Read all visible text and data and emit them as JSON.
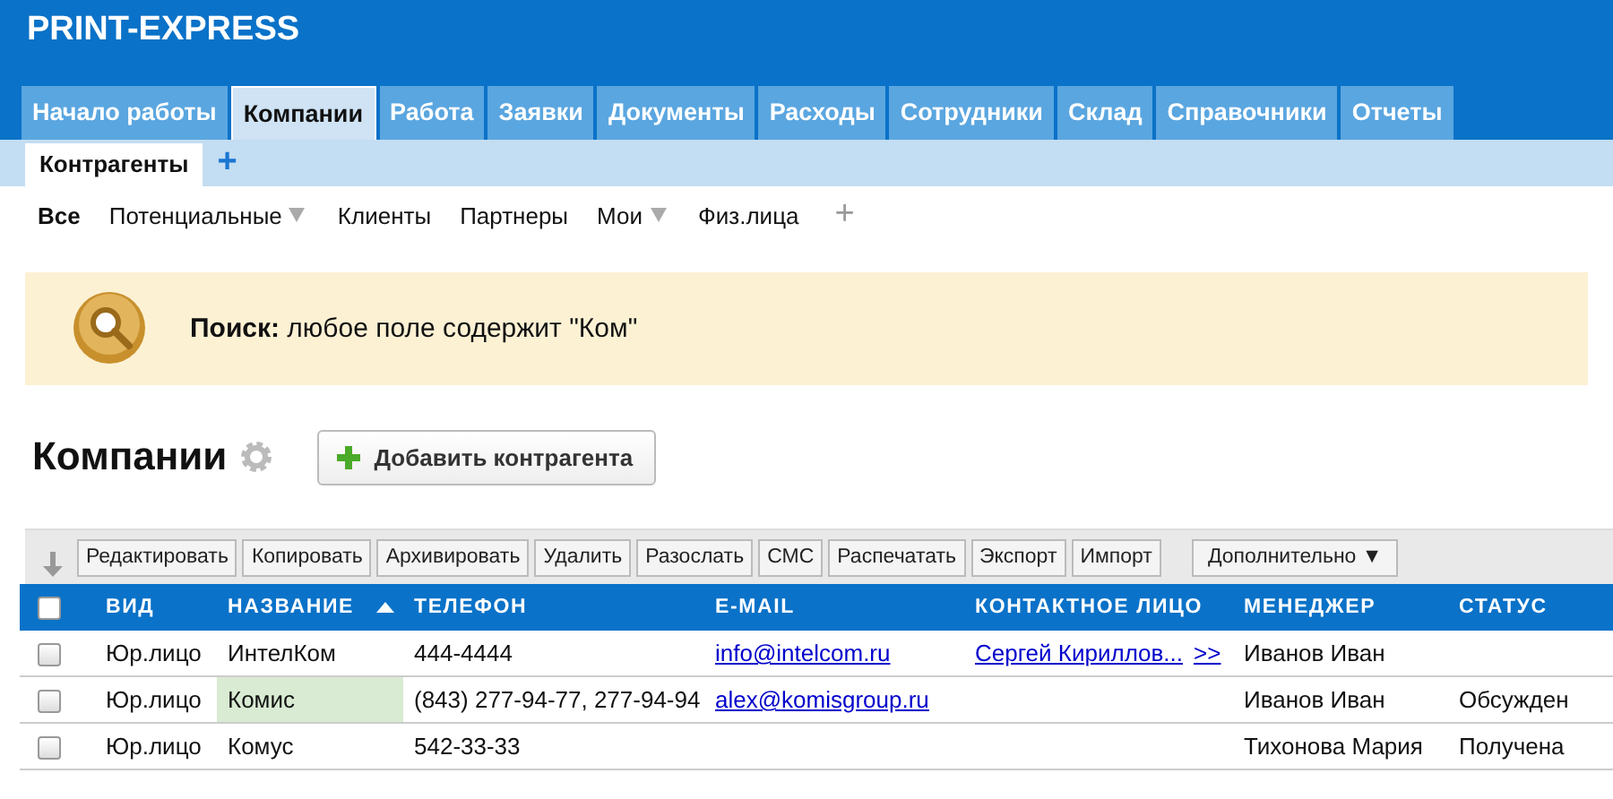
{
  "app_title": "PRINT-EXPRESS",
  "tabs": [
    {
      "label": "Начало работы",
      "selected": false
    },
    {
      "label": "Компании",
      "selected": true
    },
    {
      "label": "Работа",
      "selected": false
    },
    {
      "label": "Заявки",
      "selected": false
    },
    {
      "label": "Документы",
      "selected": false
    },
    {
      "label": "Расходы",
      "selected": false
    },
    {
      "label": "Сотрудники",
      "selected": false
    },
    {
      "label": "Склад",
      "selected": false
    },
    {
      "label": "Справочники",
      "selected": false
    },
    {
      "label": "Отчеты",
      "selected": false
    }
  ],
  "subtabs": [
    {
      "label": "Контрагенты",
      "selected": true
    }
  ],
  "subtab_add": "+",
  "filters": [
    {
      "label": "Все",
      "selected": true,
      "dropdown": false
    },
    {
      "label": "Потенциальные",
      "selected": false,
      "dropdown": true
    },
    {
      "label": "Клиенты",
      "selected": false,
      "dropdown": false
    },
    {
      "label": "Партнеры",
      "selected": false,
      "dropdown": false
    },
    {
      "label": "Мои",
      "selected": false,
      "dropdown": true
    },
    {
      "label": "Физ.лица",
      "selected": false,
      "dropdown": false
    }
  ],
  "filter_add": "+",
  "search_notice": "**Поиск:** любое поле содержит \"Ком\"",
  "heading": "Компании",
  "add_button": "Добавить контрагента",
  "toolbar": [
    "Редактировать",
    "Копировать",
    "Архивировать",
    "Удалить",
    "Разослать",
    "СМС",
    "Распечатать",
    "Экспорт",
    "Импорт"
  ],
  "more_button": "Дополнительно ▼",
  "table": {
    "all_checked": false,
    "columns": [
      {
        "label": "ВИД",
        "sorted": false
      },
      {
        "label": "НАЗВАНИЕ",
        "sorted": true
      },
      {
        "label": "ТЕЛЕФОН",
        "sorted": false
      },
      {
        "label": "E-MAIL",
        "sorted": false
      },
      {
        "label": "КОНТАКТНОЕ ЛИЦО",
        "sorted": false
      },
      {
        "label": "МЕНЕДЖЕР",
        "sorted": false
      },
      {
        "label": "СТАТУС",
        "sorted": false
      }
    ],
    "rows": [
      {
        "checked": false,
        "type": "Юр.лицо",
        "name": "ИнтелКом",
        "name_highlighted": false,
        "phone": "444-4444",
        "email": "info@intelcom.ru",
        "contact": "Сергей Кириллов...",
        "contact_more": ">>",
        "manager": "Иванов Иван"
      },
      {
        "checked": false,
        "type": "Юр.лицо",
        "name": "Комис",
        "name_highlighted": true,
        "phone": "(843) 277-94-77, 277-94-94",
        "email": "alex@komisgroup.ru",
        "manager": "Иванов Иван",
        "status": "Обсужден"
      },
      {
        "checked": false,
        "type": "Юр.лицо",
        "name": "Комус",
        "name_highlighted": false,
        "phone": "542-33-33",
        "manager": "Тихонова Мария",
        "status": "Получена"
      }
    ]
  }
}
